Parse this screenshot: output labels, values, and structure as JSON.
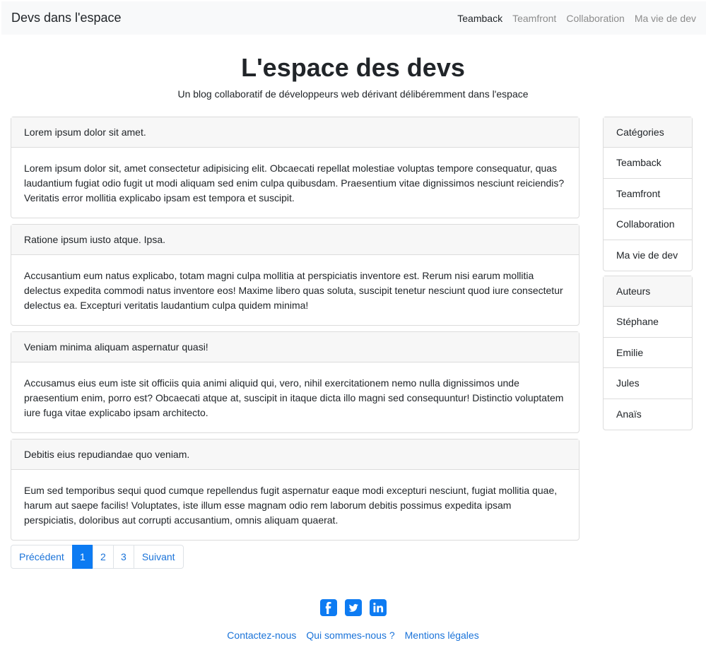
{
  "navbar": {
    "brand": "Devs dans l'espace",
    "links": [
      {
        "label": "Teamback",
        "active": true
      },
      {
        "label": "Teamfront",
        "active": false
      },
      {
        "label": "Collaboration",
        "active": false
      },
      {
        "label": "Ma vie de dev",
        "active": false
      }
    ]
  },
  "hero": {
    "title": "L'espace des devs",
    "subtitle": "Un blog collaboratif de développeurs web dérivant délibéremment dans l'espace"
  },
  "posts": [
    {
      "title": "Lorem ipsum dolor sit amet.",
      "body": "Lorem ipsum dolor sit, amet consectetur adipisicing elit. Obcaecati repellat molestiae voluptas tempore consequatur, quas laudantium fugiat odio fugit ut modi aliquam sed enim culpa quibusdam. Praesentium vitae dignissimos nesciunt reiciendis? Veritatis error mollitia explicabo ipsam est tempora et suscipit."
    },
    {
      "title": "Ratione ipsum iusto atque. Ipsa.",
      "body": "Accusantium eum natus explicabo, totam magni culpa mollitia at perspiciatis inventore est. Rerum nisi earum mollitia delectus expedita commodi natus inventore eos! Maxime libero quas soluta, suscipit tenetur nesciunt quod iure consectetur delectus ea. Excepturi veritatis laudantium culpa quidem minima!"
    },
    {
      "title": "Veniam minima aliquam aspernatur quasi!",
      "body": "Accusamus eius eum iste sit officiis quia animi aliquid qui, vero, nihil exercitationem nemo nulla dignissimos unde praesentium enim, porro est? Obcaecati atque at, suscipit in itaque dicta illo magni sed consequuntur! Distinctio voluptatem iure fuga vitae explicabo ipsam architecto."
    },
    {
      "title": "Debitis eius repudiandae quo veniam.",
      "body": "Eum sed temporibus sequi quod cumque repellendus fugit aspernatur eaque modi excepturi nesciunt, fugiat mollitia quae, harum aut saepe facilis! Voluptates, iste illum esse magnam odio rem laborum debitis possimus expedita ipsam perspiciatis, doloribus aut corrupti accusantium, omnis aliquam quaerat."
    }
  ],
  "pagination": {
    "prev": "Précédent",
    "pages": [
      "1",
      "2",
      "3"
    ],
    "current": "1",
    "next": "Suivant"
  },
  "sidebar": {
    "categories": {
      "header": "Catégories",
      "items": [
        "Teamback",
        "Teamfront",
        "Collaboration",
        "Ma vie de dev"
      ]
    },
    "authors": {
      "header": "Auteurs",
      "items": [
        "Stéphane",
        "Emilie",
        "Jules",
        "Anaïs"
      ]
    }
  },
  "footer": {
    "social_icons": [
      "facebook-icon",
      "twitter-icon",
      "linkedin-icon"
    ],
    "links": [
      "Contactez-nous",
      "Qui sommes-nous ?",
      "Mentions légales"
    ]
  },
  "colors": {
    "accent": "#0d7bf2",
    "link": "#1a73d9",
    "navbar_bg": "#f8f9fa"
  }
}
